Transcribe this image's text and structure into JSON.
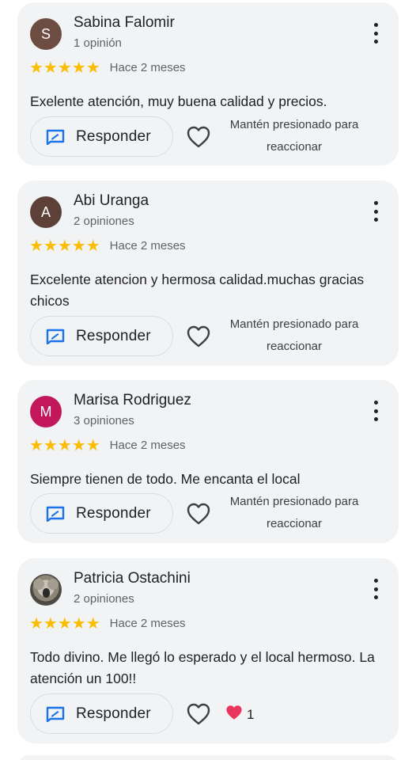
{
  "reviews": [
    {
      "initial": "S",
      "avatar_color": "#6d4c41",
      "name": "Sabina Falomir",
      "count": "1 opinión",
      "stars": "★★★★★",
      "date": "Hace 2 meses",
      "text": "Exelente atención, muy buena calidad y precios.",
      "reply_label": "Responder",
      "hold_text": "Mantén presionado para reaccionar"
    },
    {
      "initial": "A",
      "avatar_color": "#5d4037",
      "name": "Abi Uranga",
      "count": "2 opiniones",
      "stars": "★★★★★",
      "date": "Hace 2 meses",
      "text": "Excelente atencion y hermosa calidad.muchas gracias chicos",
      "reply_label": "Responder",
      "hold_text": "Mantén presionado para reaccionar"
    },
    {
      "initial": "M",
      "avatar_color": "#c2185b",
      "name": "Marisa Rodriguez",
      "count": "3 opiniones",
      "stars": "★★★★★",
      "date": "Hace 2 meses",
      "text": "Siempre tienen de todo. Me encanta el local",
      "reply_label": "Responder",
      "hold_text": "Mantén presionado para reaccionar"
    },
    {
      "name": "Patricia Ostachini",
      "count": "2 opiniones",
      "stars": "★★★★★",
      "date": "Hace 2 meses",
      "text": "Todo divino. Me llegó lo esperado y el local hermoso. La atención un 100!!",
      "reply_label": "Responder",
      "reaction_icon": "red-heart-icon",
      "reaction_count": "1"
    }
  ],
  "colors": {
    "card_bg": "#f1f3f4",
    "star": "#fbbc04",
    "reply_icon": "#1a73e8",
    "reaction_heart": "#e8375a"
  }
}
